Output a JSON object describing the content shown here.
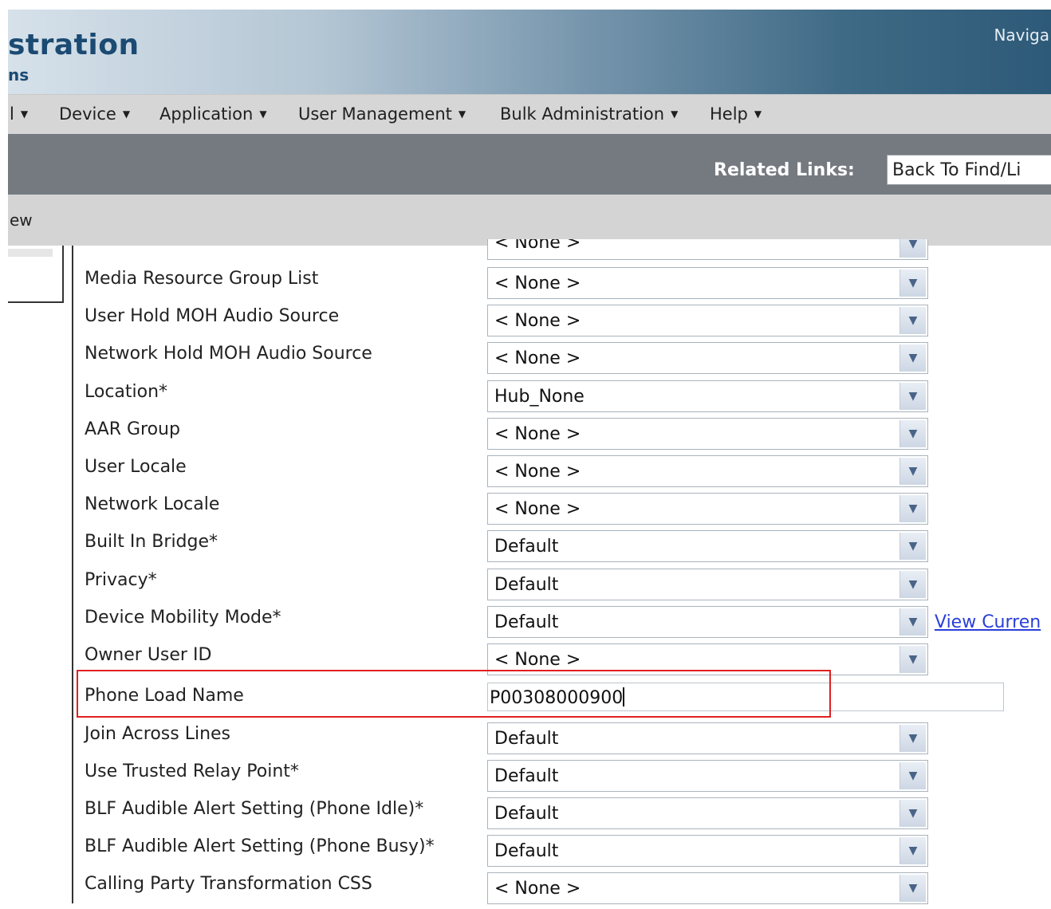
{
  "header": {
    "title": "stration",
    "subtitle": "ns",
    "nav_label": "Naviga"
  },
  "menu": {
    "items": [
      {
        "name": "menu-partial",
        "label": "l"
      },
      {
        "name": "menu-device",
        "label": "Device"
      },
      {
        "name": "menu-application",
        "label": "Application"
      },
      {
        "name": "menu-user-management",
        "label": "User Management"
      },
      {
        "name": "menu-bulk-administration",
        "label": "Bulk Administration"
      },
      {
        "name": "menu-help",
        "label": "Help"
      }
    ]
  },
  "toolbar": {
    "related_links_label": "Related Links:",
    "related_links_value": "Back To Find/Li"
  },
  "band": {
    "text": "ew"
  },
  "form": {
    "cutoff_value": "< None >",
    "rows": [
      {
        "label": "Media Resource Group List",
        "value": "< None >",
        "type": "select"
      },
      {
        "label": "User Hold MOH Audio Source",
        "value": "< None >",
        "type": "select"
      },
      {
        "label": "Network Hold MOH Audio Source",
        "value": "< None >",
        "type": "select"
      },
      {
        "label": "Location*",
        "value": "Hub_None",
        "type": "select"
      },
      {
        "label": "AAR Group",
        "value": "< None >",
        "type": "select"
      },
      {
        "label": "User Locale",
        "value": "< None >",
        "type": "select"
      },
      {
        "label": "Network Locale",
        "value": "< None >",
        "type": "select"
      },
      {
        "label": "Built In Bridge*",
        "value": "Default",
        "type": "select"
      },
      {
        "label": "Privacy*",
        "value": "Default",
        "type": "select"
      },
      {
        "label": "Device Mobility Mode*",
        "value": "Default",
        "type": "select",
        "link": "View Curren"
      },
      {
        "label": "Owner User ID",
        "value": "< None >",
        "type": "select"
      },
      {
        "label": "Phone Load Name",
        "value": "P00308000900",
        "type": "text"
      },
      {
        "label": "Join Across Lines",
        "value": "Default",
        "type": "select"
      },
      {
        "label": "Use Trusted Relay Point*",
        "value": "Default",
        "type": "select"
      },
      {
        "label": "BLF Audible Alert Setting (Phone Idle)*",
        "value": "Default",
        "type": "select"
      },
      {
        "label": "BLF Audible Alert Setting (Phone Busy)*",
        "value": "Default",
        "type": "select"
      },
      {
        "label": "Calling Party Transformation CSS",
        "value": "< None >",
        "type": "select"
      }
    ]
  },
  "icons": {
    "dropdown": "chevron-down-icon",
    "menu_caret": "caret-down-icon"
  },
  "colors": {
    "highlight": "#e02020",
    "link": "#2a3fd8",
    "title": "#1b4a72"
  }
}
